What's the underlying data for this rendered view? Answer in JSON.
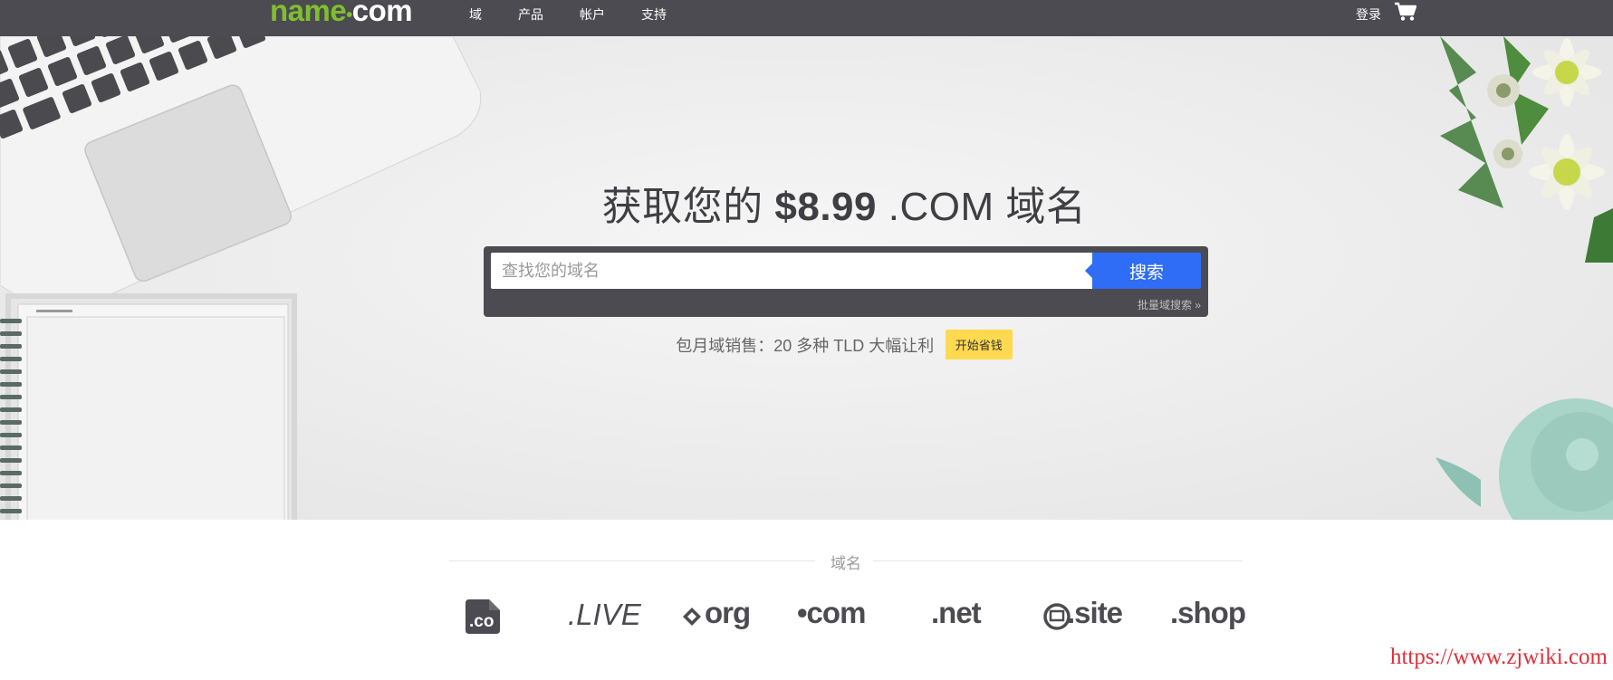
{
  "nav": {
    "logo_name": "name",
    "logo_dot": "•",
    "logo_com": "com",
    "links": [
      "域",
      "产品",
      "帐户",
      "支持"
    ],
    "login": "登录"
  },
  "hero": {
    "title_prefix": "获取您的 ",
    "title_price": "$8.99",
    "title_suffix": " .COM 域名",
    "search_placeholder": "查找您的域名",
    "search_button": "搜索",
    "bulk_search": "批量域搜索 »",
    "promo_text": "包月域销售：20 多种 TLD 大幅让利",
    "promo_button": "开始省钱"
  },
  "domains": {
    "section_title": "域名",
    "co": ".co",
    "live": ".LIVE",
    "org": "org",
    "com": "•com",
    "net": ".net",
    "site": ".site",
    "shop": ".shop"
  },
  "watermark": "https://www.zjwiki.com"
}
